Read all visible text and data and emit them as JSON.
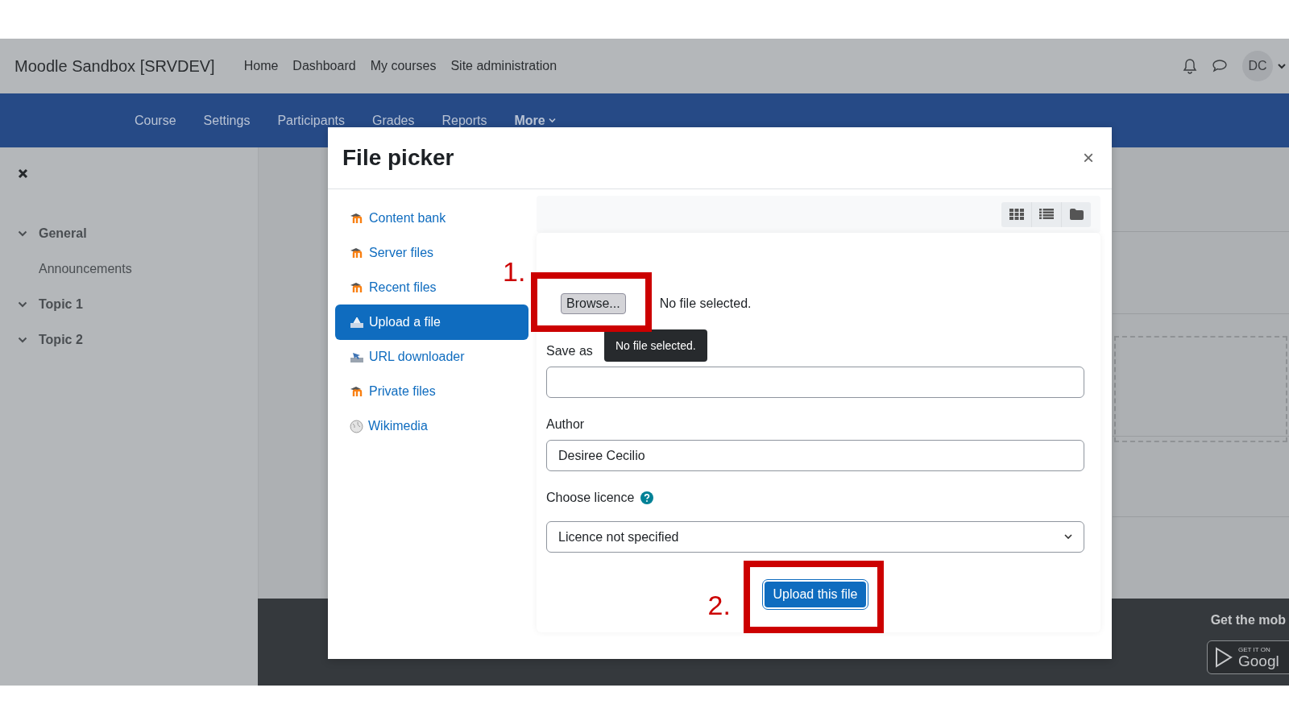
{
  "site_name": "Moodle Sandbox [SRVDEV]",
  "primary_nav": [
    "Home",
    "Dashboard",
    "My courses",
    "Site administration"
  ],
  "user": {
    "initials": "DC"
  },
  "secondary_nav": [
    {
      "label": "Course",
      "kind": "link"
    },
    {
      "label": "Settings",
      "kind": "link"
    },
    {
      "label": "Participants",
      "kind": "link"
    },
    {
      "label": "Grades",
      "kind": "link"
    },
    {
      "label": "Reports",
      "kind": "link"
    },
    {
      "label": "More",
      "kind": "dropdown"
    }
  ],
  "course_index": [
    {
      "label": "General",
      "expanded": true,
      "children": [
        {
          "label": "Announcements"
        }
      ]
    },
    {
      "label": "Topic 1",
      "expanded": true
    },
    {
      "label": "Topic 2",
      "expanded": true
    }
  ],
  "footer": {
    "app_promo": "Get the mob",
    "badge_small": "GET IT ON",
    "badge_large": "Googl"
  },
  "file_picker": {
    "title": "File picker",
    "close_label": "×",
    "repositories": [
      {
        "label": "Content bank",
        "kind": "moodle",
        "selected": false
      },
      {
        "label": "Server files",
        "kind": "moodle",
        "selected": false
      },
      {
        "label": "Recent files",
        "kind": "moodle",
        "selected": false
      },
      {
        "label": "Upload a file",
        "kind": "upload",
        "selected": true
      },
      {
        "label": "URL downloader",
        "kind": "download",
        "selected": false
      },
      {
        "label": "Private files",
        "kind": "moodle",
        "selected": false
      },
      {
        "label": "Wikimedia",
        "kind": "globe",
        "selected": false
      }
    ],
    "view_modes": [
      {
        "kind": "grid",
        "selected": false
      },
      {
        "kind": "list",
        "selected": false
      },
      {
        "kind": "tree",
        "selected": false
      }
    ],
    "browse_label": "Browse...",
    "file_status": "No file selected.",
    "tooltip": "No file selected.",
    "fields": [
      {
        "label": "Save as",
        "kind": "text"
      },
      {
        "label": "Author",
        "kind": "text",
        "value": "Desiree Cecilio"
      },
      {
        "label": "Choose licence",
        "kind": "select",
        "value": "Licence not specified",
        "help": true
      }
    ],
    "submit_label": "Upload this file"
  },
  "annotations": [
    {
      "label": "1."
    },
    {
      "label": "2."
    }
  ]
}
